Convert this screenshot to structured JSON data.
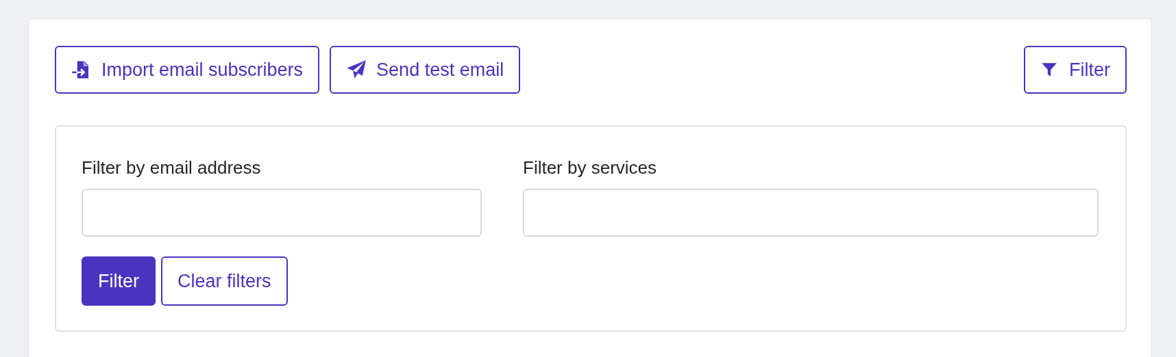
{
  "toolbar": [
    {
      "kind": "import",
      "label": "Import email subscribers"
    },
    {
      "kind": "send",
      "label": "Send test email"
    }
  ],
  "filter_toggle": {
    "label": "Filter",
    "expanded": true
  },
  "filter_panel": {
    "fields": [
      {
        "label": "Filter by email address"
      },
      {
        "label": "Filter by services"
      }
    ],
    "buttons": [
      {
        "kind": "primary",
        "label": "Filter"
      },
      {
        "kind": "outline",
        "label": "Clear filters"
      }
    ]
  }
}
